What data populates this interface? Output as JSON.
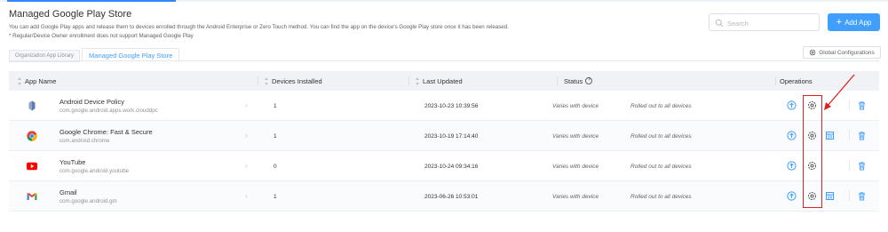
{
  "header": {
    "title": "Managed Google Play Store",
    "description": "You can add Google Play apps and release them to devices enrolled through the Android Enterprise or Zero Touch method. You can find the app on the device's Google Play store once it has been released.",
    "note": "* Regular/Device Owner enrollment does not support Managed Google Play",
    "search_placeholder": "Search",
    "add_app_label": "Add App",
    "global_config_label": "Global Configurations"
  },
  "tabs": [
    {
      "label": "Organization App Library",
      "active": false
    },
    {
      "label": "Managed Google Play Store",
      "active": true
    }
  ],
  "table": {
    "columns": {
      "app_name": "App Name",
      "devices_installed": "Devices Installed",
      "last_updated": "Last Updated",
      "status": "Status",
      "operations": "Operations"
    },
    "rows": [
      {
        "name": "Android Device Policy",
        "package": "com.google.android.apps.work.clouddpc",
        "devices": "1",
        "updated": "2023-10-23 10:39:56",
        "status": "Varies with device",
        "rollout": "Rolled out to all devices",
        "icon": "android-device-policy-icon",
        "has_config": false
      },
      {
        "name": "Google Chrome: Fast & Secure",
        "package": "com.android.chrome",
        "devices": "1",
        "updated": "2023-10-19 17:14:40",
        "status": "Varies with device",
        "rollout": "Rolled out to all devices",
        "icon": "chrome-icon",
        "has_config": true
      },
      {
        "name": "YouTube",
        "package": "com.google.android.youtube",
        "devices": "0",
        "updated": "2023-10-24 09:34:16",
        "status": "Varies with device",
        "rollout": "Rolled out to all devices",
        "icon": "youtube-icon",
        "has_config": false
      },
      {
        "name": "Gmail",
        "package": "com.google.android.gm",
        "devices": "1",
        "updated": "2023-06-26 10:53:01",
        "status": "Varies with device",
        "rollout": "Rolled out to all devices",
        "icon": "gmail-icon",
        "has_config": true
      }
    ]
  },
  "colors": {
    "accent": "#409eff",
    "annotation": "#e02020"
  }
}
